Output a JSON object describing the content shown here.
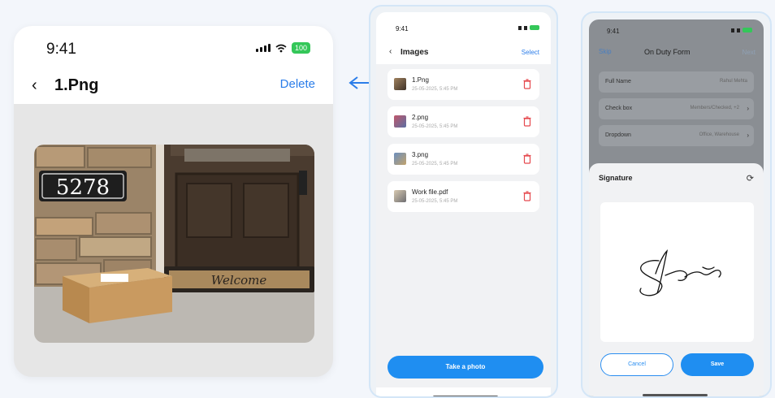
{
  "preview": {
    "status_time": "9:41",
    "battery": "100",
    "back_icon": "chevron-left-icon",
    "title": "1.Png",
    "delete_label": "Delete",
    "photo_house_number": "5278",
    "photo_mat_text": "Welcome"
  },
  "images_screen": {
    "status_time": "9:41",
    "back_icon": "chevron-left-icon",
    "title": "Images",
    "select_label": "Select",
    "items": [
      {
        "name": "1.Png",
        "meta": "25-05-2025, 5:45 PM"
      },
      {
        "name": "2.png",
        "meta": "25-05-2025, 5:45 PM"
      },
      {
        "name": "3.png",
        "meta": "25-05-2025, 5:45 PM"
      },
      {
        "name": "Work file.pdf",
        "meta": "25-05-2025, 5:45 PM"
      }
    ],
    "take_photo_label": "Take a photo"
  },
  "form_screen": {
    "status_time": "9:41",
    "skip_label": "Skip",
    "title": "On Duty Form",
    "next_label": "Next",
    "fields": [
      {
        "label": "Full Name",
        "value": "Rahul Mehta"
      },
      {
        "label": "Check box",
        "value": "Members/Checked, +2"
      },
      {
        "label": "Dropdown",
        "value": "Office, Warehouse"
      }
    ],
    "signature_title": "Signature",
    "cancel_label": "Cancel",
    "save_label": "Save"
  },
  "colors": {
    "accent": "#1f8ef1",
    "delete_text": "#2b7de9",
    "battery": "#34c759",
    "trash": "#e5484d"
  }
}
